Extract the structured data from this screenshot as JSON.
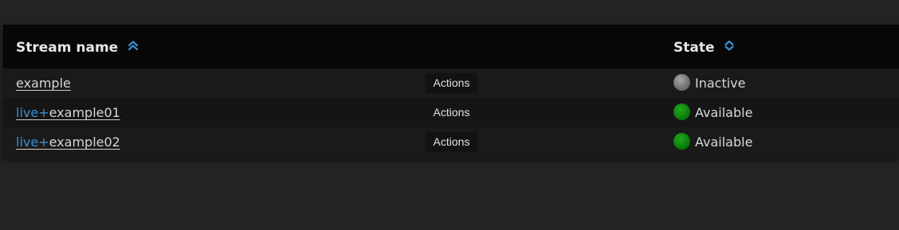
{
  "colors": {
    "background": "#232323",
    "header_bg": "#070707",
    "accent": "#3a8fd0",
    "status_inactive": "#7a7a7a",
    "status_available": "#0b8a0b"
  },
  "table": {
    "columns": {
      "stream_name": {
        "label": "Stream name",
        "sort_icon": "chevron-double-up-icon"
      },
      "state": {
        "label": "State",
        "sort_icon": "chevron-up-down-icon"
      }
    },
    "rows": [
      {
        "prefix": "",
        "name": "example",
        "actions_label": "Actions",
        "state": "Inactive",
        "state_icon": "status-dot-gray"
      },
      {
        "prefix": "live+",
        "name": "example01",
        "actions_label": "Actions",
        "state": "Available",
        "state_icon": "status-dot-green"
      },
      {
        "prefix": "live+",
        "name": "example02",
        "actions_label": "Actions",
        "state": "Available",
        "state_icon": "status-dot-green"
      }
    ]
  }
}
